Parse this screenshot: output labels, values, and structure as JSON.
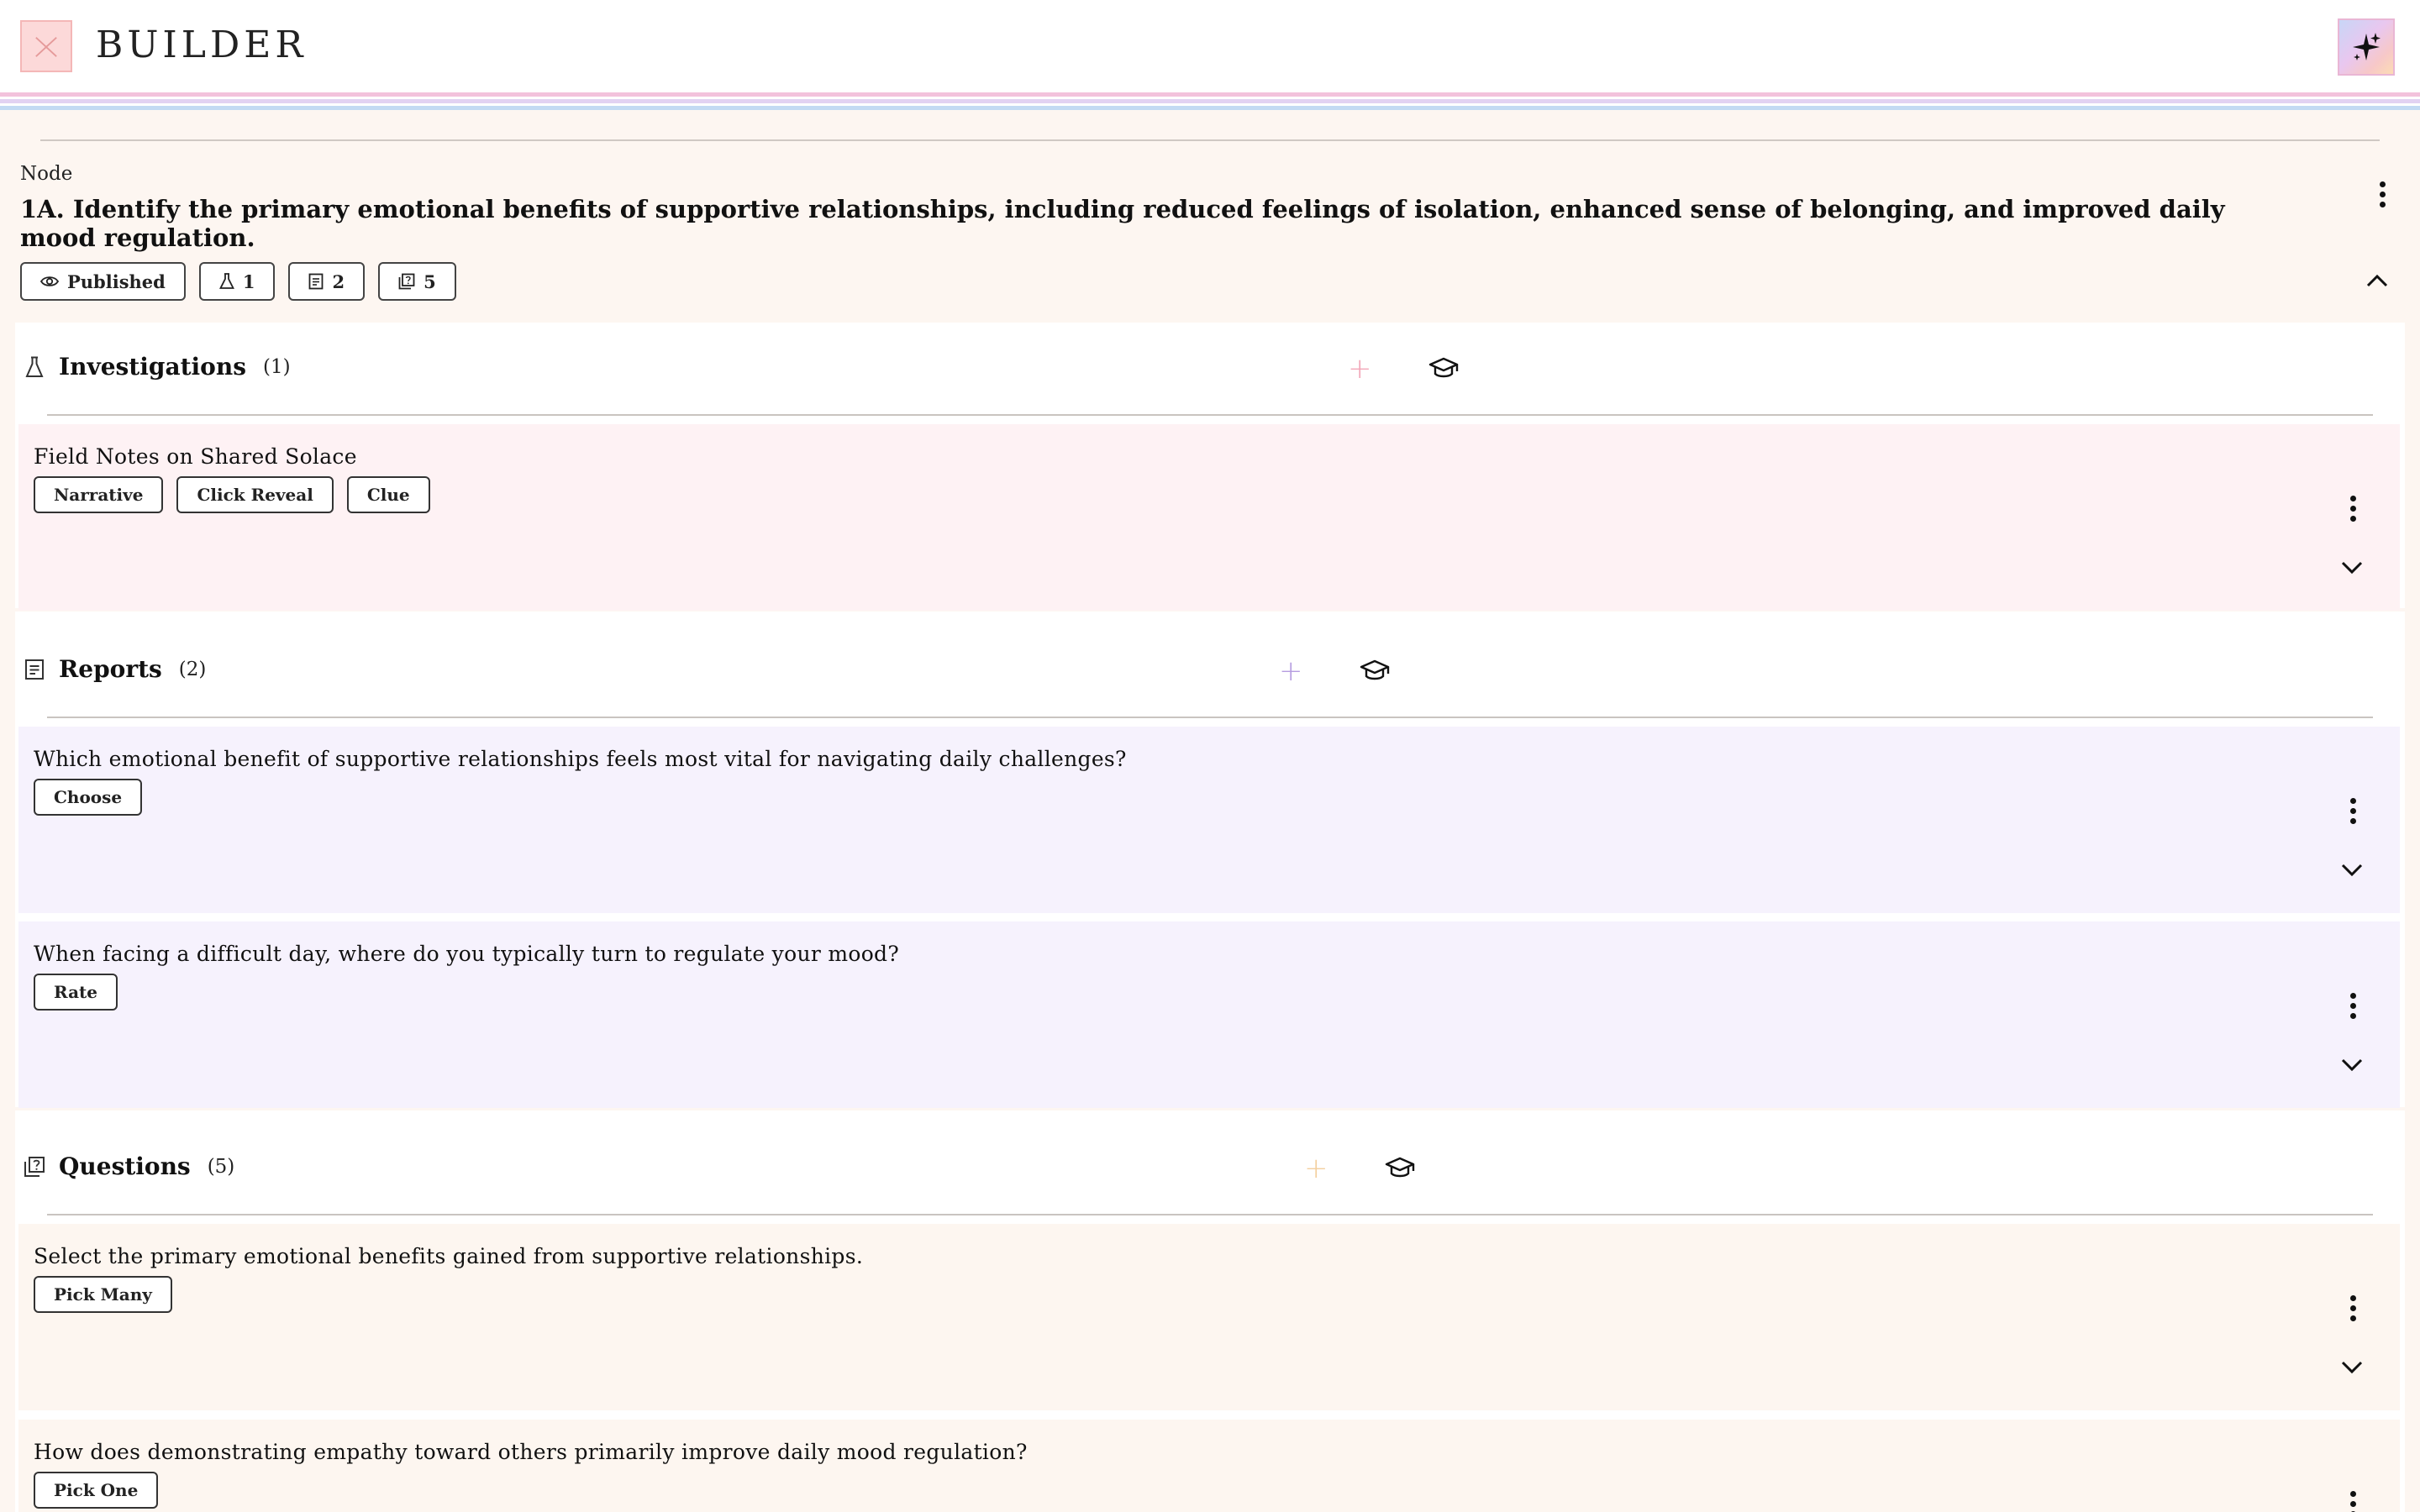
{
  "app": {
    "brand": "BUILDER",
    "logo_icon": "broken-image-icon",
    "ai_icon": "sparkle-icon"
  },
  "colors": {
    "stripe_pink": "#f3c2dc",
    "stripe_lavender": "#e2d2f2",
    "stripe_blue": "#c3daf3",
    "investigation_bg": "#fef2f4",
    "report_bg": "#f6f2fd",
    "question_bg": "#fdf6f0",
    "investigation_plus": "#f2a6b8",
    "report_plus": "#b69de0",
    "question_plus": "#f3cf9e"
  },
  "node": {
    "label": "Node",
    "title": "1A. Identify the primary emotional benefits of supportive relationships, including reduced feelings of isolation, enhanced sense of belonging, and improved daily mood regulation.",
    "status": "Published",
    "investigations_count": "1",
    "reports_count": "2",
    "questions_count": "5"
  },
  "investigations": {
    "title": "Investigations",
    "count": "(1)",
    "items": [
      {
        "title": "Field Notes on Shared Solace",
        "tags": [
          "Narrative",
          "Click Reveal",
          "Clue"
        ]
      }
    ]
  },
  "reports": {
    "title": "Reports",
    "count": "(2)",
    "items": [
      {
        "title": "Which emotional benefit of supportive relationships feels most vital for navigating daily challenges?",
        "tags": [
          "Choose"
        ]
      },
      {
        "title": "When facing a difficult day, where do you typically turn to regulate your mood?",
        "tags": [
          "Rate"
        ]
      }
    ]
  },
  "questions": {
    "title": "Questions",
    "count": "(5)",
    "items": [
      {
        "title": "Select the primary emotional benefits gained from supportive relationships.",
        "tags": [
          "Pick Many"
        ]
      },
      {
        "title": "How does demonstrating empathy toward others primarily improve daily mood regulation?",
        "tags": [
          "Pick One"
        ]
      }
    ]
  }
}
